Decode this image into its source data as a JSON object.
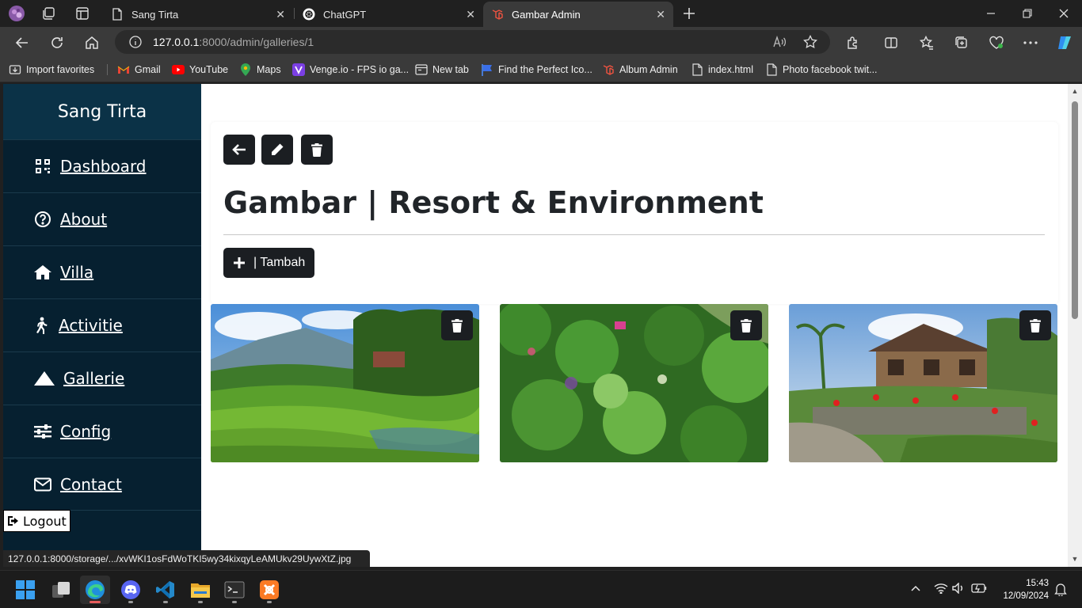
{
  "browser": {
    "tabs": [
      {
        "title": "Sang Tirta",
        "active": false
      },
      {
        "title": "ChatGPT",
        "active": false
      },
      {
        "title": "Gambar Admin",
        "active": true
      }
    ],
    "url_host": "127.0.0.1",
    "url_rest": ":8000/admin/galleries/1",
    "bookmarks": [
      {
        "label": "Import favorites",
        "icon": "import-icon"
      },
      {
        "label": "Gmail",
        "icon": "gmail-icon"
      },
      {
        "label": "YouTube",
        "icon": "youtube-icon"
      },
      {
        "label": "Maps",
        "icon": "maps-icon"
      },
      {
        "label": "Venge.io - FPS io ga...",
        "icon": "venge-icon"
      },
      {
        "label": "New tab",
        "icon": "newtab-icon"
      },
      {
        "label": "Find the Perfect Ico...",
        "icon": "flag-icon"
      },
      {
        "label": "Album Admin",
        "icon": "laravel-icon"
      },
      {
        "label": "index.html",
        "icon": "file-icon"
      },
      {
        "label": "Photo facebook twit...",
        "icon": "file-icon"
      }
    ]
  },
  "sidebar": {
    "brand": "Sang Tirta",
    "items": [
      {
        "label": "Dashboard",
        "icon": "qrcode-icon"
      },
      {
        "label": "About",
        "icon": "question-circle-icon"
      },
      {
        "label": "Villa",
        "icon": "home-icon"
      },
      {
        "label": "Activitie",
        "icon": "walking-icon"
      },
      {
        "label": "Gallerie",
        "icon": "mountain-icon"
      },
      {
        "label": "Config",
        "icon": "sliders-icon"
      },
      {
        "label": "Contact",
        "icon": "envelope-icon"
      }
    ],
    "logout": "Logout"
  },
  "main": {
    "title": "Gambar | Resort & Environment",
    "add_button": "| Tambah",
    "gallery": [
      {
        "name": "rice terrace with mountain"
      },
      {
        "name": "aerial forest view"
      },
      {
        "name": "resort building with garden"
      }
    ]
  },
  "status_url": "127.0.0.1:8000/storage/.../xvWKI1osFdWoTKI5wy34kixqyLeAMUkv29UywXtZ.jpg",
  "taskbar": {
    "time": "15:43",
    "date": "12/09/2024"
  },
  "colors": {
    "sidebar_bg": "#062030",
    "brand_bg": "#0b3247",
    "button_dark": "#1b1e22"
  }
}
